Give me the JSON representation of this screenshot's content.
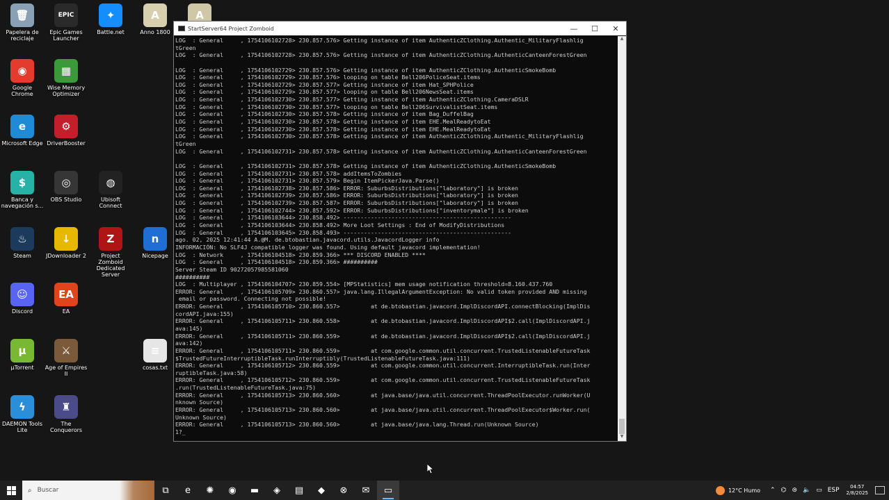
{
  "desktop_icons": [
    {
      "label": "Papelera de reciclaje",
      "icon": "recycle-bin-icon",
      "color": "#8aa0b5",
      "glyph": "🗑"
    },
    {
      "label": "Epic Games Launcher",
      "icon": "epic-games-icon",
      "color": "#2a2a2a",
      "glyph": "EPIC"
    },
    {
      "label": "Battle.net",
      "icon": "battlenet-icon",
      "color": "#148eff",
      "glyph": "✦"
    },
    {
      "label": "Anno 1800",
      "icon": "anno-1800-icon",
      "color": "#d8cfae",
      "glyph": "A"
    },
    {
      "label": "",
      "icon": "anno-icon",
      "color": "#cfc7a5",
      "glyph": "A"
    },
    {
      "label": "Google Chrome",
      "icon": "chrome-icon",
      "color": "#e33b2e",
      "glyph": "◉"
    },
    {
      "label": "Wise Memory Optimizer",
      "icon": "wise-memory-icon",
      "color": "#3a9a3a",
      "glyph": "▦"
    },
    {
      "label": "Microsoft Edge",
      "icon": "edge-icon",
      "color": "#1f8ad6",
      "glyph": "e"
    },
    {
      "label": "DriverBooster",
      "icon": "driverbooster-icon",
      "color": "#c21f2b",
      "glyph": "⚙"
    },
    {
      "label": "Banca y navegación s...",
      "icon": "banking-icon",
      "color": "#27b2a7",
      "glyph": "$"
    },
    {
      "label": "OBS Studio",
      "icon": "obs-icon",
      "color": "#363636",
      "glyph": "◎"
    },
    {
      "label": "Ubisoft Connect",
      "icon": "ubisoft-icon",
      "color": "#222",
      "glyph": "◍"
    },
    {
      "label": "Steam",
      "icon": "steam-icon",
      "color": "#1b3a5c",
      "glyph": "♨"
    },
    {
      "label": "JDownloader 2",
      "icon": "jdownloader-icon",
      "color": "#e6b800",
      "glyph": "↓"
    },
    {
      "label": "Project Zomboid Dedicated Server",
      "icon": "zomboid-icon",
      "color": "#b01515",
      "glyph": "Z"
    },
    {
      "label": "Nicepage",
      "icon": "nicepage-icon",
      "color": "#1f6ed4",
      "glyph": "n"
    },
    {
      "label": "Discord",
      "icon": "discord-icon",
      "color": "#5865f2",
      "glyph": "☺"
    },
    {
      "label": "EA",
      "icon": "ea-icon",
      "color": "#e0441c",
      "glyph": "EA"
    },
    {
      "label": "µTorrent",
      "icon": "utorrent-icon",
      "color": "#78b832",
      "glyph": "µ"
    },
    {
      "label": "Age of Empires II",
      "icon": "aoe2-icon",
      "color": "#7a5a3a",
      "glyph": "⚔"
    },
    {
      "label": "cosas.txt",
      "icon": "text-file-icon",
      "color": "#e6e6e6",
      "glyph": "≡"
    },
    {
      "label": "DAEMON Tools Lite",
      "icon": "daemon-tools-icon",
      "color": "#2a8fd8",
      "glyph": "ϟ"
    },
    {
      "label": "The Conquerors",
      "icon": "conquerors-icon",
      "color": "#4b4b8a",
      "glyph": "♜"
    }
  ],
  "console": {
    "title": "StartServer64 Project Zomboid",
    "lines": [
      "LOG  : General     , 1754106102728> 230.857.576> Getting instance of item AuthenticZClothing.Authentic_MilitaryFlashlig",
      "tGreen",
      "LOG  : General     , 1754106102728> 230.857.576> Getting instance of item AuthenticZClothing.AuthenticCanteenForestGreen",
      "",
      "LOG  : General     , 1754106102729> 230.857.576> Getting instance of item AuthenticZClothing.AuthenticSmokeBomb",
      "LOG  : General     , 1754106102729> 230.857.576> looping on table Bell206PoliceSeat.items",
      "LOG  : General     , 1754106102729> 230.857.577> Getting instance of item Hat_SPHPolice",
      "LOG  : General     , 1754106102729> 230.857.577> looping on table Bell206NewsSeat.items",
      "LOG  : General     , 1754106102730> 230.857.577> Getting instance of item AuthenticZClothing.CameraDSLR",
      "LOG  : General     , 1754106102730> 230.857.577> looping on table Bell206SurvivalistSeat.items",
      "LOG  : General     , 1754106102730> 230.857.578> Getting instance of item Bag_DuffelBag",
      "LOG  : General     , 1754106102730> 230.857.578> Getting instance of item EHE.MealReadytoEat",
      "LOG  : General     , 1754106102730> 230.857.578> Getting instance of item EHE.MealReadytoEat",
      "LOG  : General     , 1754106102730> 230.857.578> Getting instance of item AuthenticZClothing.Authentic_MilitaryFlashlig",
      "tGreen",
      "LOG  : General     , 1754106102731> 230.857.578> Getting instance of item AuthenticZClothing.AuthenticCanteenForestGreen",
      "",
      "LOG  : General     , 1754106102731> 230.857.578> Getting instance of item AuthenticZClothing.AuthenticSmokeBomb",
      "LOG  : General     , 1754106102731> 230.857.578> addItemsToZombies",
      "LOG  : General     , 1754106102731> 230.857.579> Begin ItemPickerJava.Parse()",
      "LOG  : General     , 1754106102738> 230.857.586> ERROR: SuburbsDistributions[\"laboratory\"] is broken",
      "LOG  : General     , 1754106102739> 230.857.586> ERROR: SuburbsDistributions[\"laboratory\"] is broken",
      "LOG  : General     , 1754106102739> 230.857.587> ERROR: SuburbsDistributions[\"laboratory\"] is broken",
      "LOG  : General     , 1754106102744> 230.857.592> ERROR: SuburbsDistributions[\"inventorymale\"] is broken",
      "LOG  : General     , 1754106103644> 230.858.492> -------------------------------------------------",
      "LOG  : General     , 1754106103644> 230.858.492> More Loot Settings : End of ModifyDistributions",
      "LOG  : General     , 1754106103645> 230.858.493> -------------------------------------------------",
      "ago. 02, 2025 12:41:44 A.@M. de.btobastian.javacord.utils.JavacordLogger info",
      "INFORMACIÓN: No SLF4J compatible logger was found. Using default javacord implementation!",
      "LOG  : Network     , 1754106104518> 230.859.366> *** DISCORD ENABLED ****",
      "LOG  : General     , 1754106104518> 230.859.366> ##########",
      "Server Steam ID 90272057985581060",
      "##########",
      "LOG  : Multiplayer , 1754106104707> 230.859.554> [MPStatistics] mem usage notification threshold=8.160.437.760",
      "ERROR: General     , 1754106105709> 230.860.557> java.lang.IllegalArgumentException: No valid token provided AND missing",
      " email or password. Connecting not possible!",
      "ERROR: General     , 1754106105710> 230.860.557>         at de.btobastian.javacord.ImplDiscordAPI.connectBlocking(ImplDis",
      "cordAPI.java:155)",
      "ERROR: General     , 1754106105711> 230.860.558>         at de.btobastian.javacord.ImplDiscordAPI$2.call(ImplDiscordAPI.j",
      "ava:145)",
      "ERROR: General     , 1754106105711> 230.860.559>         at de.btobastian.javacord.ImplDiscordAPI$2.call(ImplDiscordAPI.j",
      "ava:142)",
      "ERROR: General     , 1754106105711> 230.860.559>         at com.google.common.util.concurrent.TrustedListenableFutureTask",
      "$TrustedFutureInterruptibleTask.runInterruptibly(TrustedListenableFutureTask.java:111)",
      "ERROR: General     , 1754106105712> 230.860.559>         at com.google.common.util.concurrent.InterruptibleTask.run(Inter",
      "ruptibleTask.java:58)",
      "ERROR: General     , 1754106105712> 230.860.559>         at com.google.common.util.concurrent.TrustedListenableFutureTask",
      ".run(TrustedListenableFutureTask.java:75)",
      "ERROR: General     , 1754106105713> 230.860.560>         at java.base/java.util.concurrent.ThreadPoolExecutor.runWorker(U",
      "nknown Source)",
      "ERROR: General     , 1754106105713> 230.860.560>         at java.base/java.util.concurrent.ThreadPoolExecutor$Worker.run(",
      "Unknown Source)",
      "ERROR: General     , 1754106105713> 230.860.560>         at java.base/java.lang.Thread.run(Unknown Source)",
      "1?_"
    ]
  },
  "taskbar": {
    "search_placeholder": "Buscar",
    "apps": [
      {
        "icon": "task-view-icon",
        "glyph": "⧉"
      },
      {
        "icon": "edge-icon",
        "glyph": "e"
      },
      {
        "icon": "copilot-icon",
        "glyph": "✺"
      },
      {
        "icon": "chrome-icon",
        "glyph": "◉"
      },
      {
        "icon": "file-explorer-icon",
        "glyph": "▬"
      },
      {
        "icon": "app-icon",
        "glyph": "◈"
      },
      {
        "icon": "store-icon",
        "glyph": "▤"
      },
      {
        "icon": "app-icon",
        "glyph": "◆"
      },
      {
        "icon": "xbox-icon",
        "glyph": "⊗"
      },
      {
        "icon": "outlook-icon",
        "glyph": "✉"
      },
      {
        "icon": "terminal-icon",
        "glyph": "▭"
      }
    ],
    "weather": "12°C  Humo",
    "lang": "ESP",
    "time": "04:57",
    "date": "2/8/2025"
  }
}
